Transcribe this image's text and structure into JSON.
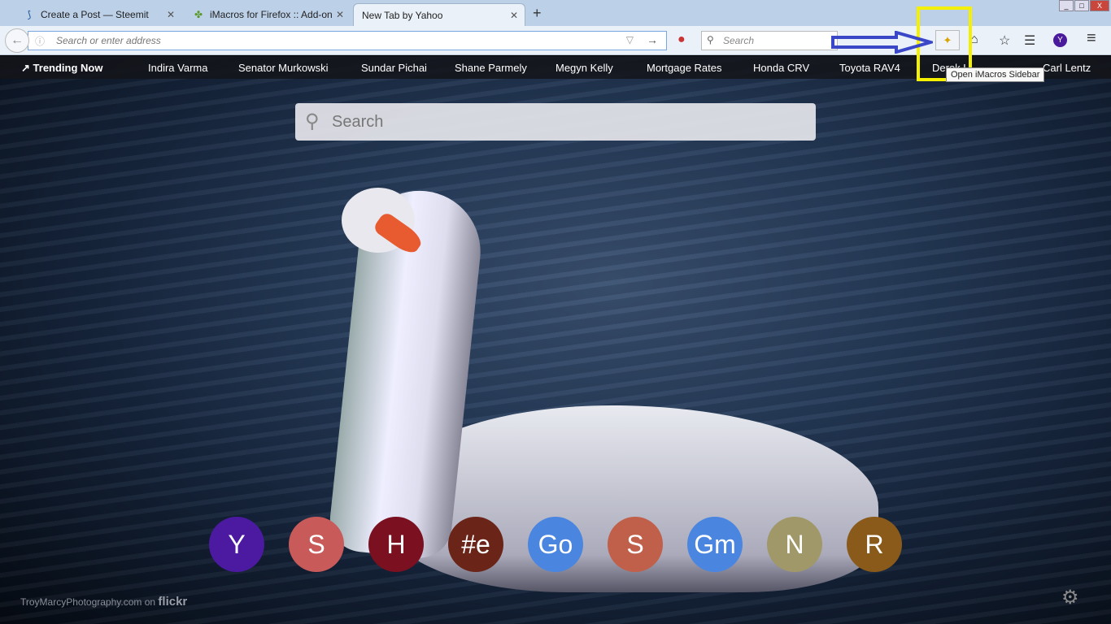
{
  "tabs": [
    {
      "title": "Create a Post — Steemit",
      "icon": "steemit-icon"
    },
    {
      "title": "iMacros for Firefox :: Add-ons",
      "icon": "puzzle-icon"
    },
    {
      "title": "New Tab by Yahoo",
      "icon": ""
    }
  ],
  "new_tab": "+",
  "window": {
    "min": "_",
    "max": "□",
    "close": "X"
  },
  "nav": {
    "back": "←",
    "info": "ⓘ",
    "url_placeholder": "Search or enter address",
    "dropdown": "▽",
    "go": "→",
    "search_placeholder": "Search",
    "search_icon": "🔍"
  },
  "toolbar": {
    "imacros_tooltip": "Open iMacros Sidebar",
    "yahoo_letter": "Y",
    "home": "⌂",
    "bookmark": "☆",
    "reader": "☰",
    "menu": "≡",
    "imacros": "✦",
    "pocket": "●"
  },
  "trending": {
    "label": "Trending Now",
    "icon": "↗",
    "items": [
      "Indira Varma",
      "Senator Murkowski",
      "Sundar Pichai",
      "Shane Parmely",
      "Megyn Kelly",
      "Mortgage Rates",
      "Honda CRV",
      "Toyota RAV4",
      "Derek H",
      "Carl Lentz"
    ]
  },
  "page_search": {
    "placeholder": "Search",
    "icon": "⚲"
  },
  "shortcuts": [
    {
      "letter": "Y",
      "color": "#4b1aa0"
    },
    {
      "letter": "S",
      "color": "#c85a5a"
    },
    {
      "letter": "H",
      "color": "#7a1020"
    },
    {
      "letter": "#e",
      "color": "#6b2418"
    },
    {
      "letter": "Go",
      "color": "#4a86e0"
    },
    {
      "letter": "S",
      "color": "#c0604a"
    },
    {
      "letter": "Gm",
      "color": "#4a86e0"
    },
    {
      "letter": "N",
      "color": "#a09868"
    },
    {
      "letter": "R",
      "color": "#8a5a1a"
    }
  ],
  "credit": {
    "author": "TroyMarcyPhotography.com on",
    "site": "flickr"
  },
  "settings_icon": "⚙"
}
